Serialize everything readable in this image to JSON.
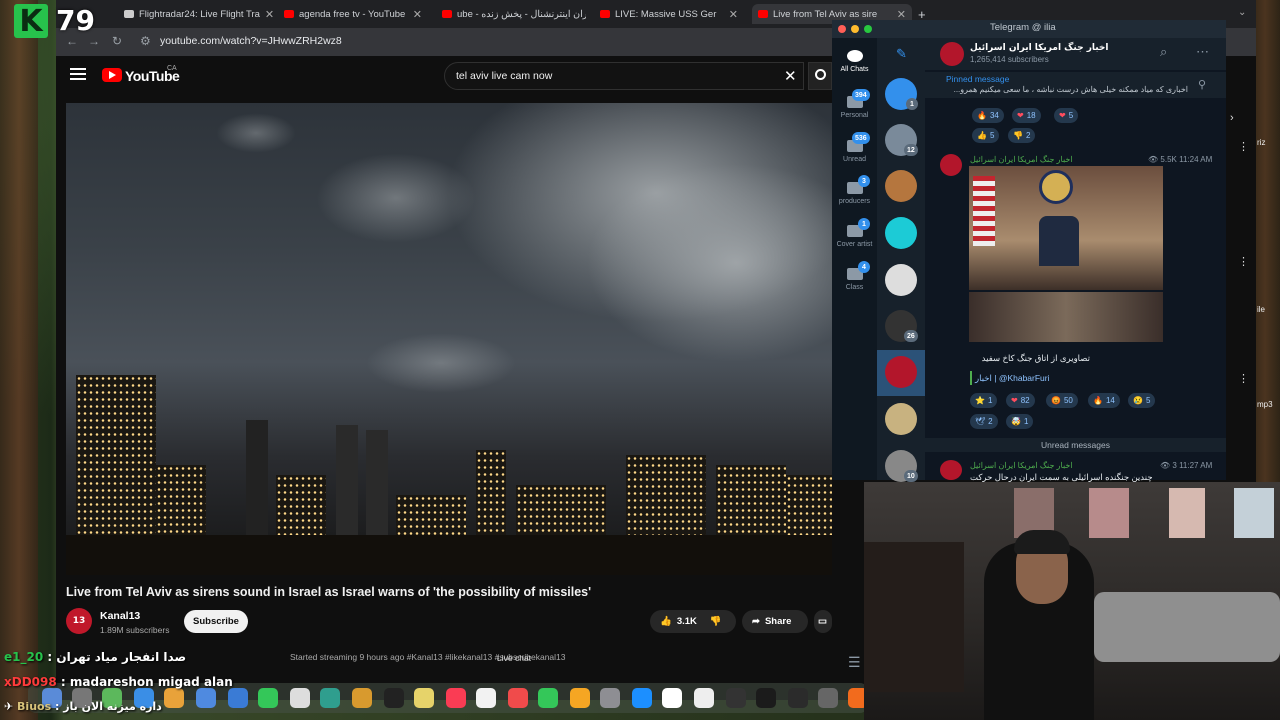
{
  "overlay": {
    "counter": "79",
    "chat": [
      {
        "user": "e1_20",
        "text": "صدا انفجار میاد تهران",
        "color": "#27c24c"
      },
      {
        "user": "xDD098",
        "text": "madareshon migad alan",
        "color": "#ff3b3b"
      },
      {
        "user": "Biuos",
        "text": "داره میزنه الان باز",
        "color": "#d7c27a"
      }
    ]
  },
  "browser": {
    "tabs": [
      {
        "label": "Flightradar24: Live Flight Tra"
      },
      {
        "label": "agenda free tv - YouTube"
      },
      {
        "label": "ube - ایران اینترنشنال - پخش زنده"
      },
      {
        "label": "LIVE: Massive USS Ger"
      },
      {
        "label": "Live from Tel Aviv as sire"
      }
    ],
    "url": "youtube.com/watch?v=JHwwZRH2wz8"
  },
  "youtube": {
    "logo_text": "YouTube",
    "region": "CA",
    "search_value": "tel aviv live cam now",
    "video_title": "Live from Tel Aviv as sirens sound in Israel as Israel warns of 'the possibility of missiles'",
    "channel": {
      "name": "Kanal13",
      "subscribers": "1.89M subscribers",
      "avatar_text": "13"
    },
    "subscribe_label": "Subscribe",
    "likes": "3.1K",
    "share_label": "Share",
    "description_snippet": "Started streaming 9 hours ago  #Kanal13 #likekanal13 #subscribekanal13",
    "live_chat_label": "Live chat"
  },
  "telegram": {
    "window_title": "Telegram @ ilia",
    "folders": [
      {
        "label": "All Chats",
        "badge": ""
      },
      {
        "label": "Personal",
        "badge": "394"
      },
      {
        "label": "Unread",
        "badge": "536"
      },
      {
        "label": "producers",
        "badge": "3"
      },
      {
        "label": "Cover artist",
        "badge": "1"
      },
      {
        "label": "Class",
        "badge": "4"
      }
    ],
    "chat_badges": [
      "1",
      "12",
      "",
      "",
      "",
      "26",
      "",
      "",
      "10"
    ],
    "channel_name": "اخبار جنگ امریکا ایران اسرائیل",
    "channel_subs": "1,265,414 subscribers",
    "pinned_label": "Pinned message",
    "pinned_text": "اخباری که میاد ممکنه خیلی هاش درست نباشه ، ما سعی میکنیم همرو...",
    "reactions_top": [
      {
        "emoji": "🔥",
        "count": "34"
      },
      {
        "emoji": "❤",
        "count": "18"
      },
      {
        "emoji": "❤",
        "count": "5"
      },
      {
        "emoji": "👍",
        "count": "5"
      },
      {
        "emoji": "👎",
        "count": "2"
      }
    ],
    "post": {
      "author": "اخبار جنگ امریکا ایران اسرائیل",
      "views": "5.5K",
      "time": "11:24 AM",
      "caption": "تصاویری از اتاق جنگ کاخ سفید",
      "signature": "اخبار | @KhabarFuri",
      "reactions": [
        {
          "emoji": "⭐",
          "count": "1"
        },
        {
          "emoji": "❤",
          "count": "82"
        },
        {
          "emoji": "😡",
          "count": "50"
        },
        {
          "emoji": "🔥",
          "count": "14"
        },
        {
          "emoji": "😢",
          "count": "5"
        },
        {
          "emoji": "🕊",
          "count": "2"
        },
        {
          "emoji": "🤯",
          "count": "1"
        }
      ]
    },
    "unread_label": "Unread messages",
    "last_post": {
      "author": "اخبار جنگ امریکا ایران اسرائیل",
      "views": "3",
      "time": "11:27 AM",
      "text": "چندین جنگنده اسرائیلی به سمت ایران درحال حرکت"
    }
  },
  "right_edge": [
    "riz",
    "ile",
    "mp3"
  ]
}
